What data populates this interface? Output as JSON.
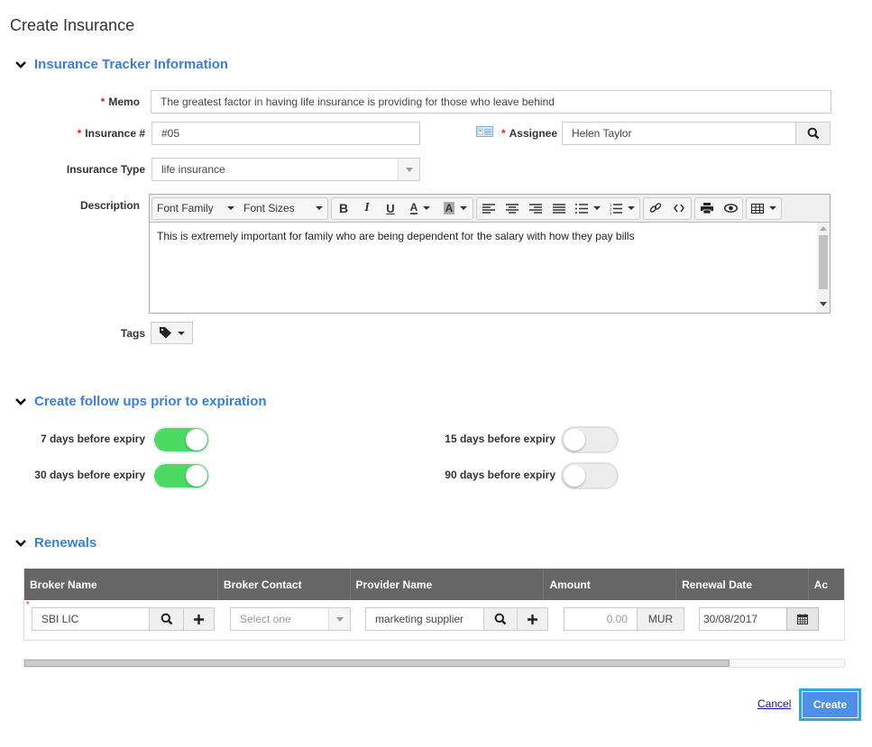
{
  "page": {
    "title": "Create Insurance"
  },
  "sections": {
    "tracker": {
      "title": "Insurance Tracker Information"
    },
    "followups": {
      "title": "Create follow ups prior to expiration"
    },
    "renewals": {
      "title": "Renewals"
    }
  },
  "form": {
    "memo": {
      "label": "Memo",
      "required": "*",
      "value": "The greatest factor in having life insurance is providing for those who leave behind"
    },
    "insurance_no": {
      "label": "Insurance #",
      "required": "*",
      "value": "#05"
    },
    "assignee": {
      "label": "Assignee",
      "required": "*",
      "value": "Helen Taylor"
    },
    "insurance_type": {
      "label": "Insurance Type",
      "value": "life insurance"
    },
    "description": {
      "label": "Description",
      "font_family": "Font Family",
      "font_sizes": "Font Sizes",
      "value": "This is extremely important for family who are being dependent for the salary with how they pay bills"
    },
    "tags": {
      "label": "Tags"
    }
  },
  "followups": [
    {
      "label": "7 days before expiry",
      "on": true
    },
    {
      "label": "15 days before expiry",
      "on": false
    },
    {
      "label": "30 days before expiry",
      "on": true
    },
    {
      "label": "90 days before expiry",
      "on": false
    }
  ],
  "renewals": {
    "columns": [
      "Broker Name",
      "Broker Contact",
      "Provider Name",
      "Amount",
      "Renewal Date",
      "Ac"
    ],
    "row": {
      "required": "*",
      "broker_name": "SBI LIC",
      "broker_contact_placeholder": "Select one",
      "provider_name": "marketing supplier",
      "amount_placeholder": "0.00",
      "currency": "MUR",
      "renewal_date": "30/08/2017"
    },
    "scroll_position_percent": 86
  },
  "actions": {
    "cancel": "Cancel",
    "create": "Create"
  },
  "colors": {
    "accent": "#3a7fd5",
    "toggle_on": "#4cd964",
    "header_bg": "#666666",
    "create_bg": "#4f8fe8"
  }
}
